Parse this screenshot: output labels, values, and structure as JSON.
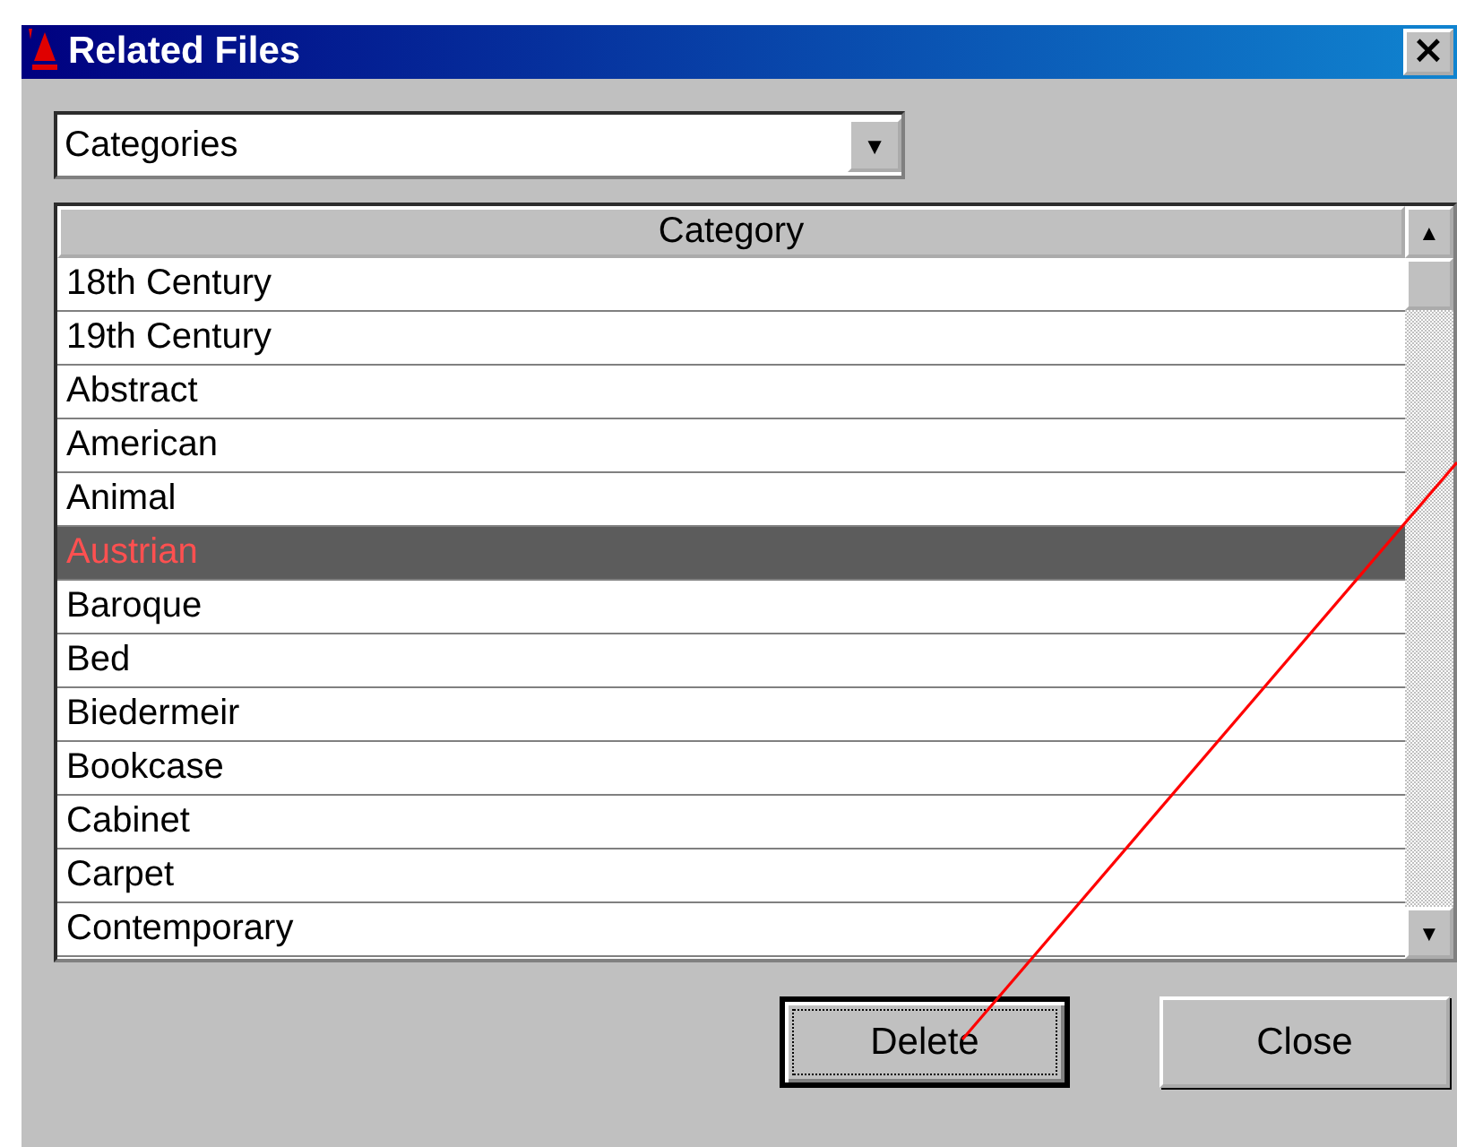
{
  "window": {
    "title": "Related Files",
    "close": "×"
  },
  "dropdown": {
    "value": "Categories",
    "arrow": "▼"
  },
  "table": {
    "columns": [
      "Category"
    ],
    "rows": [
      {
        "cells": [
          "18th Century"
        ],
        "selected": false
      },
      {
        "cells": [
          "19th Century"
        ],
        "selected": false
      },
      {
        "cells": [
          "Abstract"
        ],
        "selected": false
      },
      {
        "cells": [
          "American"
        ],
        "selected": false
      },
      {
        "cells": [
          "Animal"
        ],
        "selected": false
      },
      {
        "cells": [
          "Austrian"
        ],
        "selected": true
      },
      {
        "cells": [
          "Baroque"
        ],
        "selected": false
      },
      {
        "cells": [
          "Bed"
        ],
        "selected": false
      },
      {
        "cells": [
          "Biedermeir"
        ],
        "selected": false
      },
      {
        "cells": [
          "Bookcase"
        ],
        "selected": false
      },
      {
        "cells": [
          "Cabinet"
        ],
        "selected": false
      },
      {
        "cells": [
          "Carpet"
        ],
        "selected": false
      },
      {
        "cells": [
          "Contemporary"
        ],
        "selected": false
      }
    ],
    "scroll_up": "▲",
    "scroll_down": "▼"
  },
  "buttons": [
    {
      "label": "Delete",
      "focused": true
    },
    {
      "label": "Close",
      "focused": false
    }
  ]
}
